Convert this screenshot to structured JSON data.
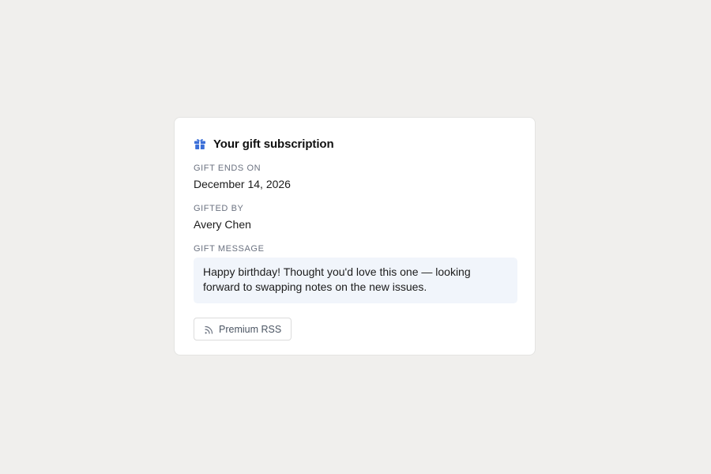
{
  "card": {
    "title": "Your gift subscription",
    "icon": "gift-icon",
    "accent_color": "#3b6fd8"
  },
  "fields": {
    "ends_on": {
      "label": "GIFT ENDS ON",
      "value": "December 14, 2026"
    },
    "gifted_by": {
      "label": "GIFTED BY",
      "value": "Avery Chen"
    },
    "message": {
      "label": "GIFT MESSAGE",
      "value": "Happy birthday! Thought you'd love this one — looking forward to swapping notes on the new issues."
    }
  },
  "actions": {
    "rss": {
      "label": "Premium RSS",
      "icon": "rss-icon"
    }
  }
}
